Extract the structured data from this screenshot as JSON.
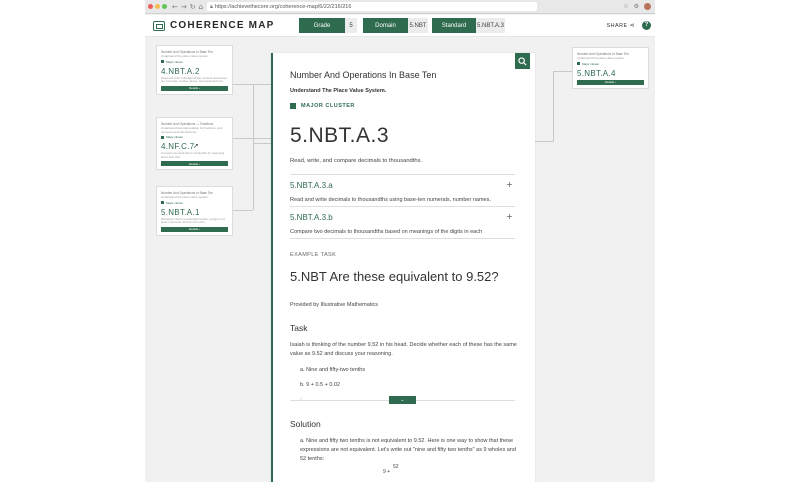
{
  "browser": {
    "url": "https://achievethecore.org/coherence-map/6/22/216/216",
    "lock_icon": "lock-icon",
    "nav_icons": [
      "back-arrow-icon",
      "forward-arrow-icon",
      "reload-icon",
      "home-icon"
    ],
    "right_icons": [
      "star-icon",
      "extension-icon",
      "profile-avatar"
    ]
  },
  "header": {
    "logo_text": "COHERENCE MAP",
    "grade_label": "Grade",
    "grade_value": "5",
    "domain_label": "Domain",
    "domain_value": "5.NBT",
    "standard_label": "Standard",
    "standard_value": "5.NBT.A.3",
    "share_label": "SHARE",
    "help_label": "?"
  },
  "left_cards": [
    {
      "heading": "Number And Operations In Base Ten",
      "subheading": "Understand the place value system.",
      "cluster": "Major cluster",
      "code": "4.NBT.A.2",
      "desc": "Read and write multi-digit whole numbers using base-ten numerals, number names, and expanded form.",
      "button": "Details ›"
    },
    {
      "heading": "Number And Operations — Fractions",
      "subheading": "Understand decimal notation for fractions, and compare decimal fractions.",
      "cluster": "Major cluster",
      "code": "4.NF.C.7",
      "desc": "Compare two decimals to hundredths by reasoning about their size.",
      "button": "Details ›"
    },
    {
      "heading": "Number And Operations In Base Ten",
      "subheading": "Understand the place value system.",
      "cluster": "Major cluster",
      "code": "5.NBT.A.1",
      "desc": "Recognize that in a multi-digit number, a digit in one place represents 10 times as much.",
      "button": "Details ›"
    }
  ],
  "right_card": {
    "heading": "Number And Operations In Base Ten",
    "subheading": "Understand the place value system.",
    "cluster": "Major cluster",
    "code": "5.NBT.A.4",
    "button": "Details ›"
  },
  "main": {
    "domain_title": "Number And Operations In Base Ten",
    "cluster_desc": "Understand The Place Value System.",
    "cluster_badge": "MAJOR CLUSTER",
    "standard_code": "5.NBT.A.3",
    "standard_desc": "Read, write, and compare decimals to thousandths.",
    "substandards": [
      {
        "code": "5.NBT.A.3.a",
        "desc": "Read and write decimals to thousandths using base-ten numerals, number names,"
      },
      {
        "code": "5.NBT.A.3.b",
        "desc": "Compare two decimals to thousandths based on meanings of the digits in each"
      }
    ],
    "example_label": "EXAMPLE TASK",
    "example_title": "5.NBT Are these equivalent to 9.52?",
    "provided_by": "Provided by Illustrative Mathematics",
    "task_heading": "Task",
    "task_body": "Isaiah is thinking of the number 9.52 in his head. Decide whether each of these has the same value as 9.52 and discuss your reasoning.",
    "task_items": [
      "a. Nine and fifty-two tenths",
      "b. 9 + 0.5 + 0.02"
    ],
    "task_cut": "c. ............",
    "solution_heading": "Solution",
    "solution_body": "a. Nine and fifty two tenths is not equivalent to 9.52. Here is one way to show that these expressions are not equivalent. Let's write out \"nine and fifty two tenths\" as 9 wholes and 52 tenths:",
    "fraction_num": "52",
    "fraction_pre": "9 +"
  }
}
